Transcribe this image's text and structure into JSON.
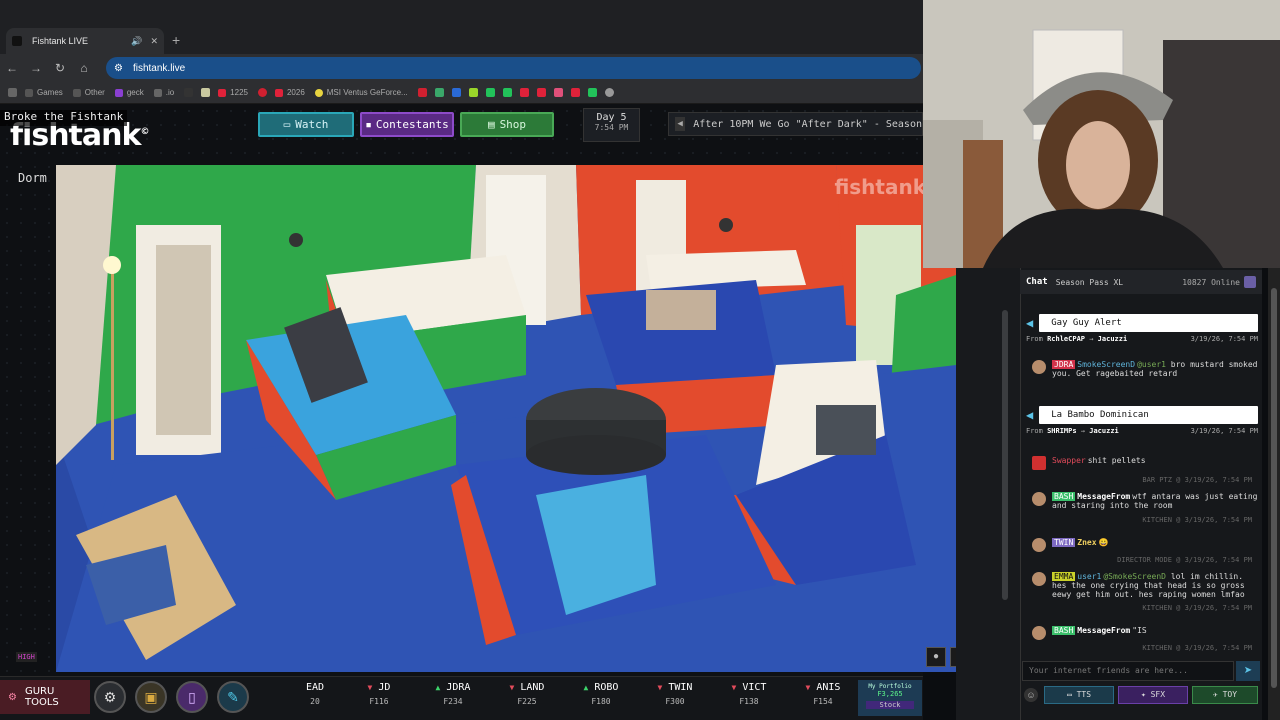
{
  "browser": {
    "tab_title": "Fishtank LIVE",
    "url": "fishtank.live",
    "bookmarks": [
      "Games",
      "Other",
      "geck",
      ".io",
      "1225",
      "2026",
      "MSI Ventus GeForce..."
    ]
  },
  "site": {
    "banner": "Broke the Fishtank",
    "logo": "fishtank",
    "nav": {
      "watch": "Watch",
      "contestants": "Contestants",
      "shop": "Shop"
    },
    "day": {
      "label": "Day 5",
      "time": "7:54 PM"
    },
    "ticker": "After 10PM We Go \"After Dark\" - Season",
    "room": "Dorm",
    "watermark": "fishtank",
    "quality": "HIGH"
  },
  "bottombar": {
    "guru_label": "GURU TOOLS",
    "tickers": [
      {
        "name": "EAD",
        "price": "20",
        "dir": ""
      },
      {
        "name": "JD",
        "price": "F116",
        "dir": "down"
      },
      {
        "name": "JDRA",
        "price": "F234",
        "dir": "up"
      },
      {
        "name": "LAND",
        "price": "F225",
        "dir": "down"
      },
      {
        "name": "ROBO",
        "price": "F180",
        "dir": "up"
      },
      {
        "name": "TWIN",
        "price": "F300",
        "dir": "down"
      },
      {
        "name": "VICT",
        "price": "F138",
        "dir": "down"
      },
      {
        "name": "ANIS",
        "price": "F154",
        "dir": "down"
      }
    ],
    "portfolio": {
      "label": "My Portfolio",
      "value": "F3,265",
      "stock": "Stock"
    }
  },
  "chat": {
    "title": "Chat",
    "subtitle": "Season Pass XL",
    "online": "10827 Online",
    "input_placeholder": "Your internet friends are here...",
    "buttons": {
      "tts": "TTS",
      "sfx": "SFX",
      "toy": "TOY"
    },
    "messages": {
      "tip1": {
        "text": "Gay Guy Alert",
        "from": "From",
        "user": "RchleCPAP",
        "to": "Jacuzzi",
        "time": "3/19/26, 7:54 PM"
      },
      "m1": {
        "tag": "JDRA",
        "user": "SmokeScreenD",
        "mention": "@user1",
        "text": "bro mustard smoked you. Get ragebaited retard"
      },
      "tip2": {
        "text": "La Bambo Dominican",
        "from": "From",
        "user": "SHRIMPs",
        "to": "Jacuzzi",
        "time": "3/19/26, 7:54 PM"
      },
      "m2": {
        "user": "Swapper",
        "text": "shit pellets"
      },
      "loc1": "BAR PTZ @ 3/19/26, 7:54 PM",
      "m3": {
        "tag": "BASH",
        "user": "MessageFrom",
        "text": "wtf antara was just eating and staring into the room"
      },
      "loc2": "KITCHEN @ 3/19/26, 7:54 PM",
      "m4": {
        "tag": "TWIN",
        "user": "Znex",
        "text": "😀"
      },
      "loc3": "DIRECTOR MODE @ 3/19/26, 7:54 PM",
      "m5": {
        "tag": "EMMA",
        "user": "user1",
        "mention": "@SmokeScreenD",
        "text": "lol im chillin. hes the one crying that head is so gross eewy get him out. hes raping women lmfao"
      },
      "loc4": "KITCHEN @ 3/19/26, 7:54 PM",
      "m6": {
        "tag": "BASH",
        "user": "MessageFrom",
        "text": "\"IS"
      },
      "loc5": "KITCHEN @ 3/19/26, 7:54 PM"
    }
  }
}
